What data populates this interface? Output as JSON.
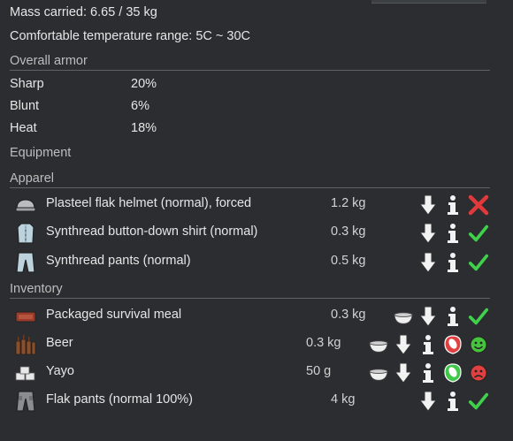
{
  "header": {
    "mass_carried": "Mass carried: 6.65 / 35 kg",
    "comfortable_temp": "Comfortable temperature range: 5C ~ 30C"
  },
  "overall_armor": {
    "title": "Overall armor",
    "rows": [
      {
        "label": "Sharp",
        "value": "20%"
      },
      {
        "label": "Blunt",
        "value": "6%"
      },
      {
        "label": "Heat",
        "value": "18%"
      }
    ]
  },
  "equipment": {
    "title": "Equipment"
  },
  "apparel": {
    "title": "Apparel",
    "items": [
      {
        "name": "Plasteel flak helmet (normal), forced",
        "mass": "1.2 kg",
        "icon": "helmet-icon",
        "status": "forbidden"
      },
      {
        "name": "Synthread button-down shirt (normal)",
        "mass": "0.3 kg",
        "icon": "shirt-icon",
        "status": "allowed"
      },
      {
        "name": "Synthread pants (normal)",
        "mass": "0.5 kg",
        "icon": "pants-icon",
        "status": "allowed"
      }
    ]
  },
  "inventory": {
    "title": "Inventory",
    "items": [
      {
        "name": "Packaged survival meal",
        "mass": "0.3 kg",
        "icon": "meal-icon",
        "consume": true,
        "drug_policy": false,
        "status": "allowed"
      },
      {
        "name": "Beer",
        "mass": "0.3 kg",
        "icon": "beer-icon",
        "consume": true,
        "drug_policy": "red",
        "mood": "happy"
      },
      {
        "name": "Yayo",
        "mass": "50 g",
        "icon": "yayo-icon",
        "consume": true,
        "drug_policy": "green",
        "mood": "angry"
      },
      {
        "name": "Flak pants (normal 100%)",
        "mass": "4 kg",
        "icon": "flak-pants-icon",
        "consume": false,
        "drug_policy": false,
        "status": "allowed"
      }
    ]
  },
  "colors": {
    "background": "#2b2d30",
    "check": "#3fd14a",
    "cross": "#e23a3a",
    "happy": "#47c43d",
    "angry": "#e04040"
  }
}
